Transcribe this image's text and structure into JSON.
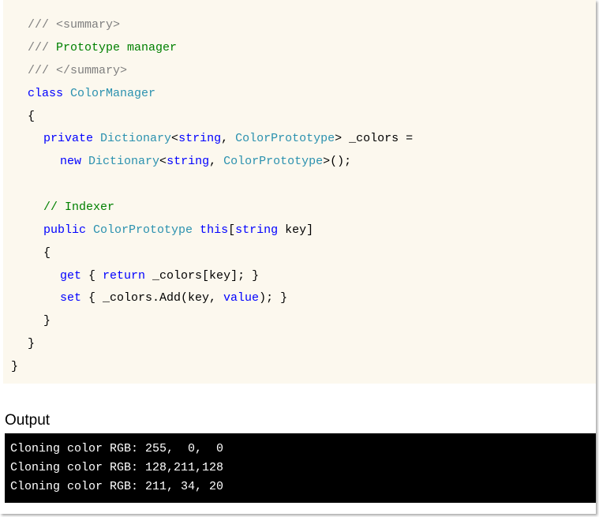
{
  "colors": {
    "code_background": "#fcf8ee",
    "keyword": "#0000ff",
    "type": "#2b91af",
    "comment": "#008000",
    "xmldoc": "#808080",
    "console_background": "#000000",
    "console_text": "#ffffff"
  },
  "code": {
    "l1": {
      "xmldoc": "/// <summary>"
    },
    "l2": {
      "xmldoc": "/// ",
      "comment": "Prototype manager"
    },
    "l3": {
      "xmldoc": "/// </summary>"
    },
    "l4": {
      "keyword": "class",
      "space": " ",
      "type": "ColorManager"
    },
    "l5": {
      "text": "{"
    },
    "l6": {
      "kw_private": "private",
      "sp1": " ",
      "type_dict": "Dictionary",
      "lt": "<",
      "kw_string": "string",
      "comma": ", ",
      "type_proto": "ColorPrototype",
      "rest": "> _colors ="
    },
    "l7": {
      "kw_new": "new",
      "sp1": " ",
      "type_dict": "Dictionary",
      "lt": "<",
      "kw_string": "string",
      "comma": ", ",
      "type_proto": "ColorPrototype",
      "rest": ">();"
    },
    "l8": {
      "comment": "// Indexer"
    },
    "l9": {
      "kw_public": "public",
      "sp1": " ",
      "type_proto": "ColorPrototype",
      "sp2": " ",
      "kw_this": "this",
      "bracket": "[",
      "kw_string": "string",
      "rest": " key]"
    },
    "l10": {
      "text": "{"
    },
    "l11": {
      "kw_get": "get",
      "mid": " { ",
      "kw_return": "return",
      "rest": " _colors[key]; }"
    },
    "l12": {
      "kw_set": "set",
      "mid": " { _colors.Add(key, ",
      "kw_value": "value",
      "rest": "); }"
    },
    "l13": {
      "text": "}"
    },
    "l14": {
      "text": "}"
    },
    "l15": {
      "text": "}"
    }
  },
  "output": {
    "label": "Output",
    "lines": [
      "Cloning color RGB: 255,  0,  0",
      "Cloning color RGB: 128,211,128",
      "Cloning color RGB: 211, 34, 20"
    ]
  }
}
